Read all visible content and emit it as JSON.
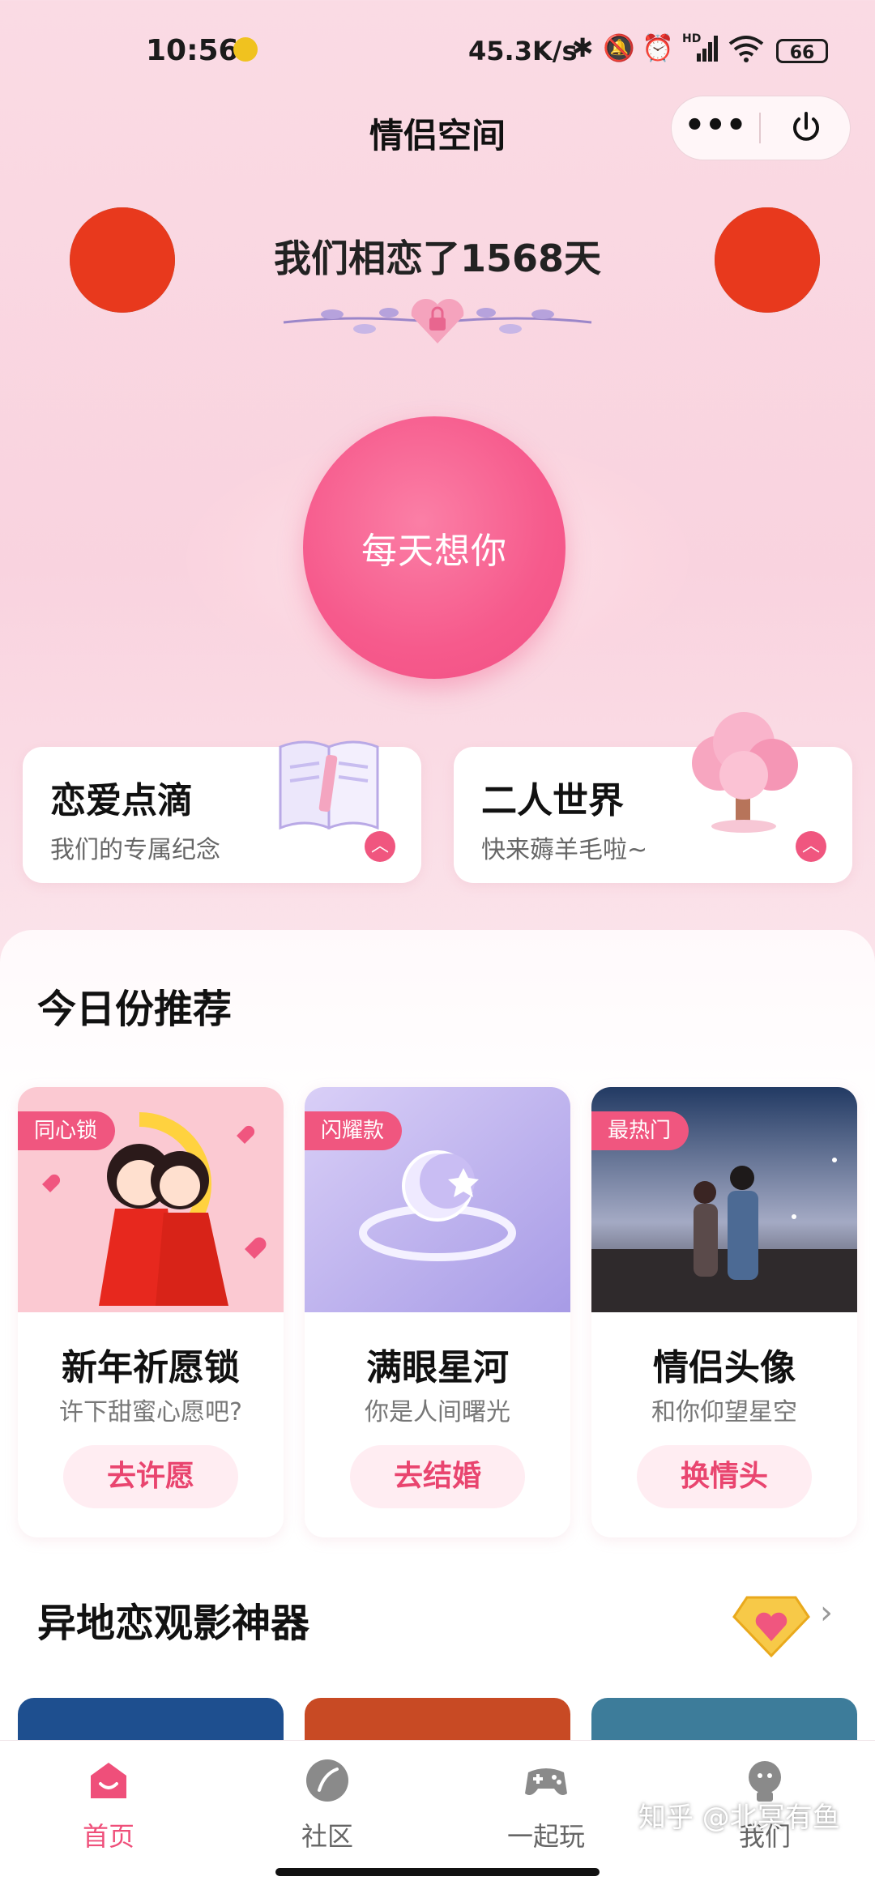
{
  "status_bar": {
    "time": "10:56",
    "network_speed": "45.3K/s",
    "battery": "66",
    "network_label": "HD"
  },
  "nav": {
    "title": "情侣空间"
  },
  "header": {
    "days_text": "我们相恋了1568天"
  },
  "main_button": {
    "label": "每天想你"
  },
  "feature_cards": [
    {
      "title": "恋爱点滴",
      "subtitle": "我们的专属纪念"
    },
    {
      "title": "二人世界",
      "subtitle": "快来薅羊毛啦~"
    }
  ],
  "recommend": {
    "title": "今日份推荐",
    "items": [
      {
        "tag": "同心锁",
        "name": "新年祈愿锁",
        "desc": "许下甜蜜心愿吧?",
        "button": "去许愿"
      },
      {
        "tag": "闪耀款",
        "name": "满眼星河",
        "desc": "你是人间曙光",
        "button": "去结婚"
      },
      {
        "tag": "最热门",
        "name": "情侣头像",
        "desc": "和你仰望星空",
        "button": "换情头"
      }
    ]
  },
  "movie": {
    "title": "异地恋观影神器"
  },
  "bottom_nav": [
    {
      "label": "首页",
      "active": true
    },
    {
      "label": "社区",
      "active": false
    },
    {
      "label": "一起玩",
      "active": false
    },
    {
      "label": "我们",
      "active": false
    }
  ],
  "watermark": "知乎 @北冥有鱼",
  "colors": {
    "accent": "#f0567f",
    "active_tab": "#ef4f7a",
    "inactive_tab": "#666666"
  }
}
